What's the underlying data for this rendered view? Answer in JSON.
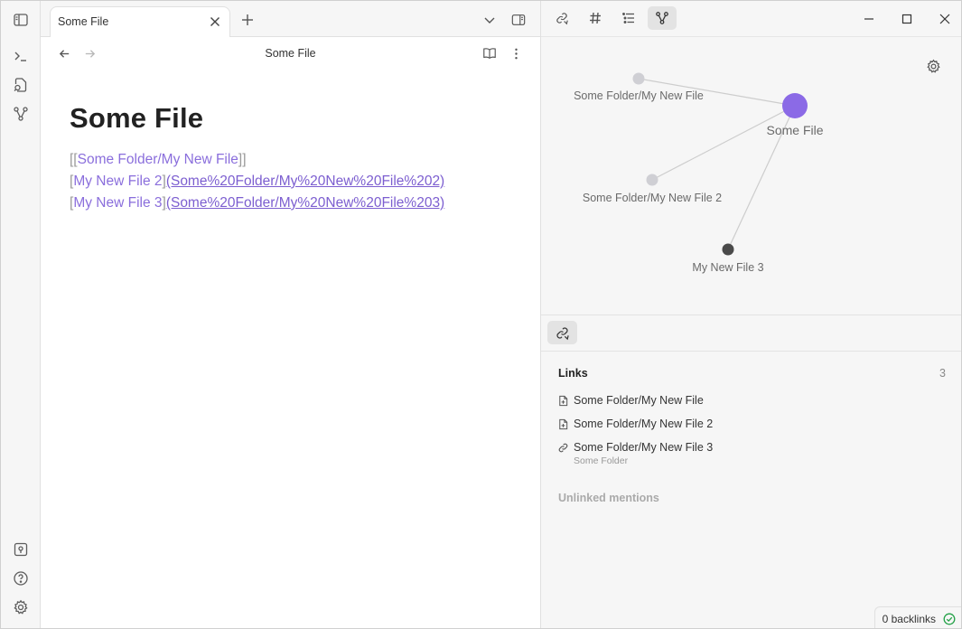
{
  "tab": {
    "title": "Some File"
  },
  "view": {
    "title": "Some File"
  },
  "document": {
    "title": "Some File",
    "lines": [
      {
        "open": "[[",
        "text": "Some Folder/My New File",
        "close": "]]"
      },
      {
        "open": "[",
        "text": "My New File 2",
        "close": "]",
        "url": "(Some%20Folder/My%20New%20File%202)"
      },
      {
        "open": "[",
        "text": "My New File 3",
        "close": "]",
        "url": "(Some%20Folder/My%20New%20File%203)"
      }
    ]
  },
  "graph": {
    "nodes": [
      {
        "label": "Some File",
        "role": "current",
        "color": "#8b6ae6"
      },
      {
        "label": "Some Folder/My New File",
        "role": "resolved",
        "color": "#cfcfd4"
      },
      {
        "label": "Some Folder/My New File 2",
        "role": "resolved",
        "color": "#cfcfd4"
      },
      {
        "label": "My New File 3",
        "role": "unresolved",
        "color": "#4a4a4a"
      }
    ]
  },
  "links_panel": {
    "heading": "Links",
    "count": "3",
    "items": [
      {
        "text": "Some Folder/My New File",
        "icon": "file-icon"
      },
      {
        "text": "Some Folder/My New File 2",
        "icon": "file-icon"
      },
      {
        "text": "Some Folder/My New File 3",
        "icon": "link-icon",
        "sub": "Some Folder"
      }
    ],
    "unlinked": "Unlinked mentions"
  },
  "status": {
    "backlinks": "0 backlinks"
  },
  "colors": {
    "accent": "#8b6ae6",
    "link": "#8a6edc",
    "sync_ok": "#24a148"
  }
}
